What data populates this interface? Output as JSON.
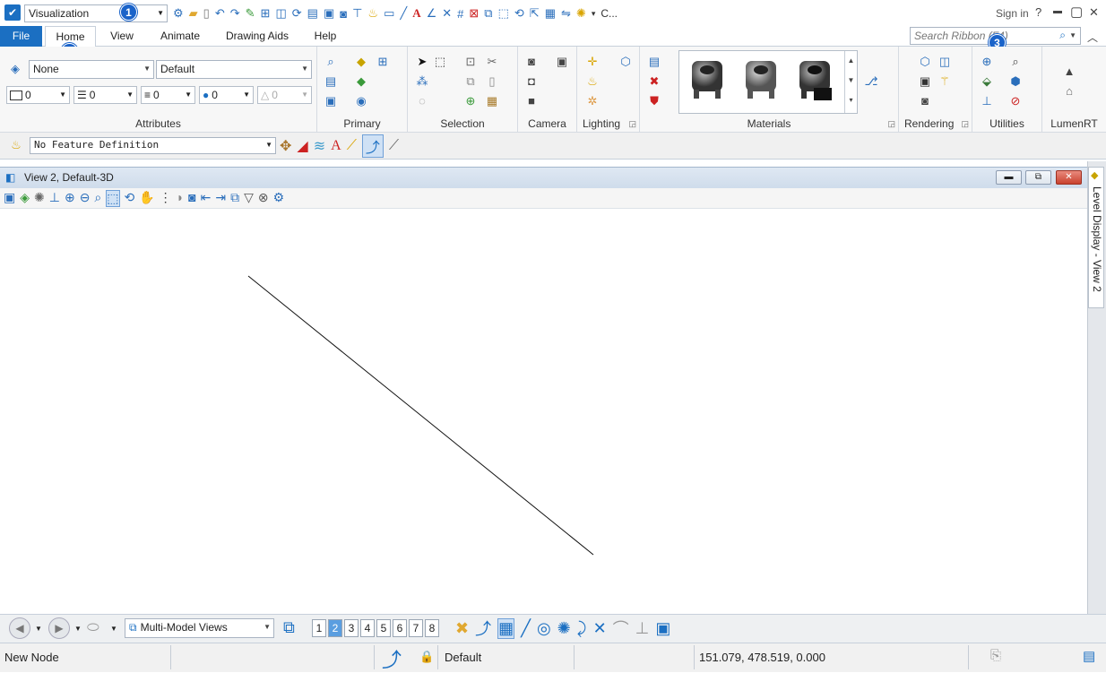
{
  "titlebar": {
    "workspace": "Visualization",
    "more_label": "C...",
    "sign_in": "Sign in",
    "help": "?",
    "minimize": "▬",
    "maximize": "▢",
    "close": "✕"
  },
  "callouts": [
    "1",
    "2",
    "3"
  ],
  "tabs": [
    "File",
    "Home",
    "View",
    "Animate",
    "Drawing Aids",
    "Help"
  ],
  "search": {
    "placeholder": "Search Ribbon (F4)"
  },
  "ribbon": {
    "attributes": {
      "level": "None",
      "style": "Default",
      "color": "0",
      "weight": "0",
      "linestyle": "0",
      "priority": "0",
      "transparency": "0",
      "label": "Attributes"
    },
    "groups": [
      "Primary",
      "Selection",
      "Camera",
      "Lighting",
      "Materials",
      "Rendering",
      "Utilities",
      "LumenRT"
    ]
  },
  "feature": {
    "definition": "No Feature Definition"
  },
  "view": {
    "title": "View 2, Default-3D",
    "level_display": "Level Display - View 2"
  },
  "viewbar": {
    "mode": "Multi-Model Views",
    "numbers": [
      "1",
      "2",
      "3",
      "4",
      "5",
      "6",
      "7",
      "8"
    ],
    "active": "2"
  },
  "status": {
    "message": "New Node",
    "level": "Default",
    "coordinates": "151.079, 478.519, 0.000"
  },
  "colors": {
    "accent": "#1b6fc2",
    "badge": "#1a63c9",
    "window_close": "#c9422f"
  }
}
